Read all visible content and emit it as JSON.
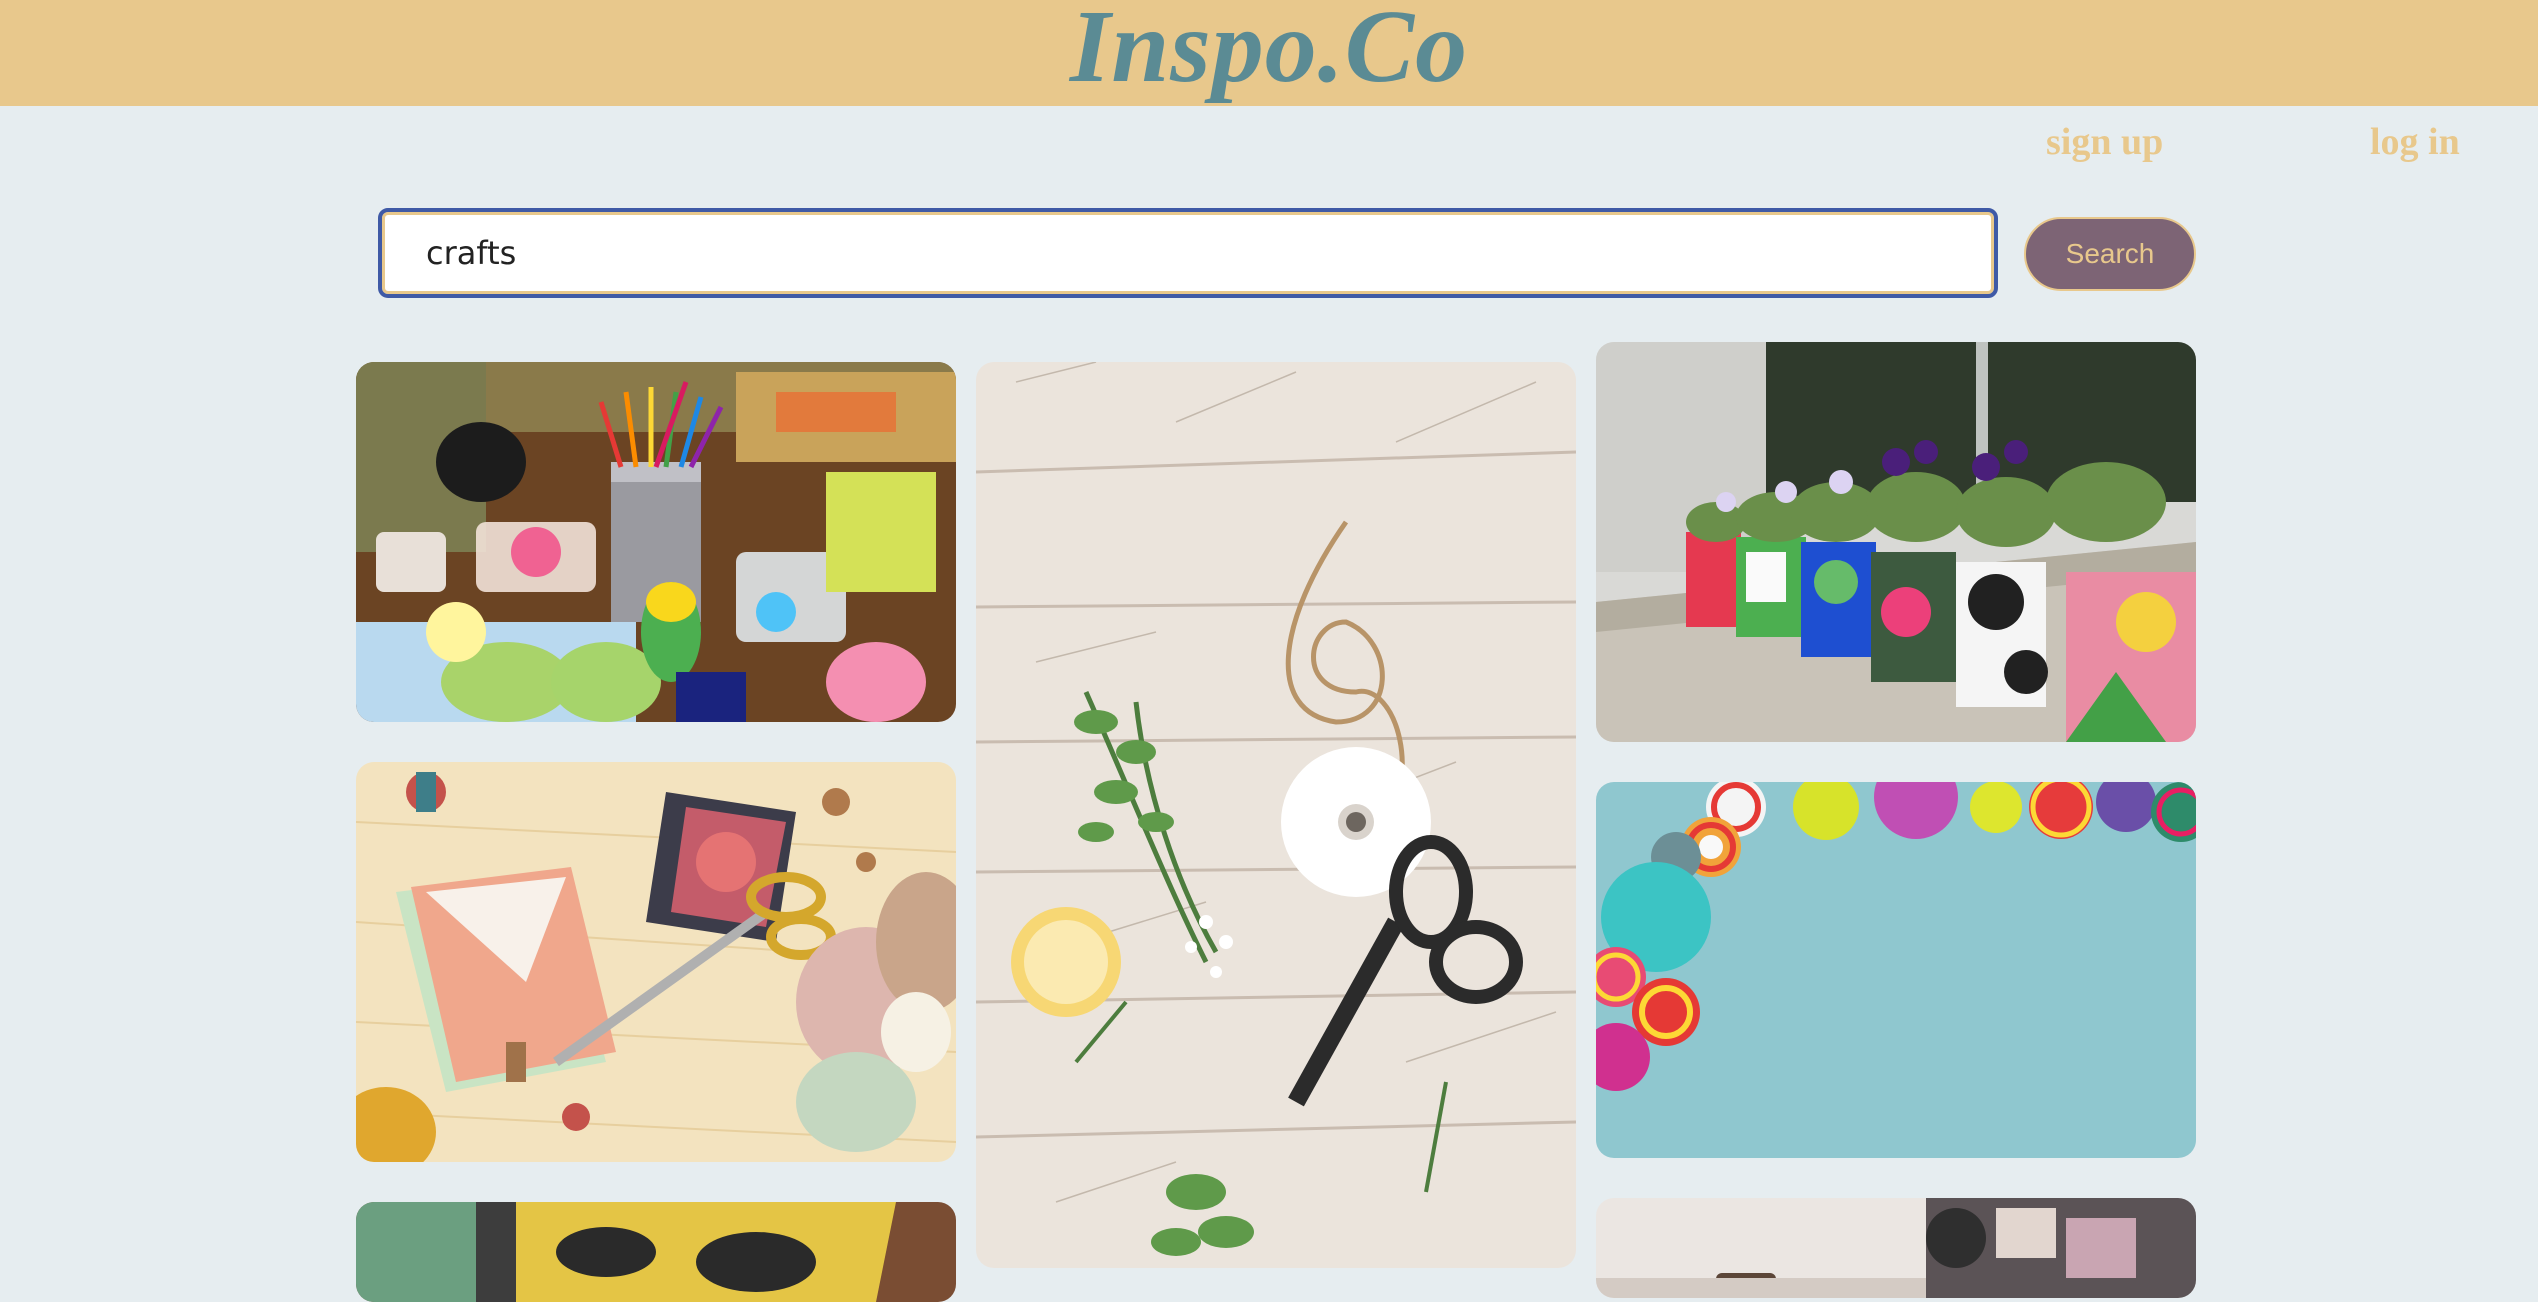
{
  "app": {
    "logo": "Inspo.Co"
  },
  "nav": {
    "signup_label": "sign up",
    "login_label": "log in"
  },
  "search": {
    "value": "crafts",
    "button_label": "Search"
  },
  "colors": {
    "header_bg": "#e8c88c",
    "logo": "#5b8b94",
    "page_bg": "#e6edf0",
    "button_bg": "#7d6475",
    "accent": "#e8c88c"
  },
  "gallery": {
    "columns": [
      [
        "craft-supplies-photo",
        "envelope-scissors-yarn-photo",
        "paper-craft-photo"
      ],
      [
        "twine-scissors-herbs-photo"
      ],
      [
        "painted-flower-pots-photo",
        "felt-balls-photo",
        "craft-studio-photo"
      ]
    ]
  }
}
